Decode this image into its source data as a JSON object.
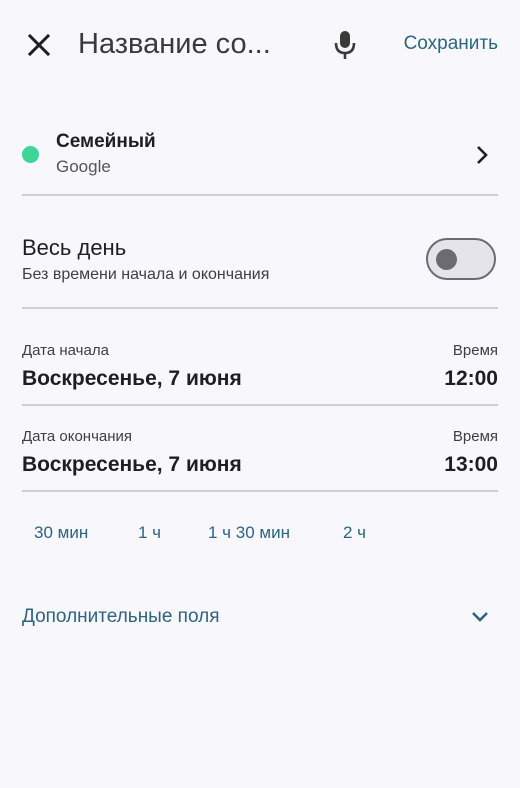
{
  "topbar": {
    "title": "Название со...",
    "save_label": "Сохранить"
  },
  "calendar": {
    "name": "Семейный",
    "account": "Google",
    "color": "#3ed598"
  },
  "all_day": {
    "title": "Весь день",
    "subtitle": "Без времени начала и окончания",
    "enabled": false
  },
  "start": {
    "date_label": "Дата начала",
    "date_value": "Воскресенье, 7 июня",
    "time_label": "Время",
    "time_value": "12:00"
  },
  "end": {
    "date_label": "Дата окончания",
    "date_value": "Воскресенье, 7 июня",
    "time_label": "Время",
    "time_value": "13:00"
  },
  "durations": [
    "30 мин",
    "1 ч",
    "1 ч 30 мин",
    "2 ч"
  ],
  "more_fields": {
    "label": "Дополнительные поля"
  },
  "colors": {
    "accent": "#2c6580",
    "background": "#f7f7fc"
  },
  "icons": {
    "close": "close-icon",
    "mic": "microphone-icon",
    "chevron_right": "chevron-right-icon",
    "chevron_down": "chevron-down-icon"
  }
}
